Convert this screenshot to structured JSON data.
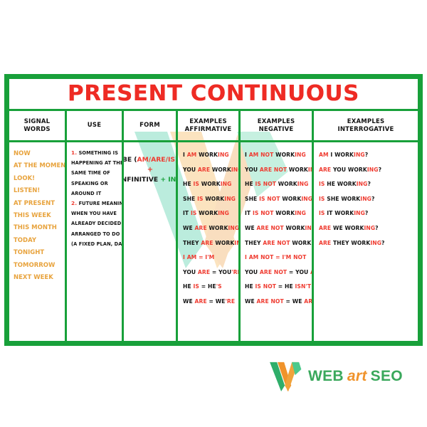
{
  "title": "PRESENT CONTINUOUS",
  "colors": {
    "frame_green": "#18a03a",
    "title_red": "#ee2b24",
    "accent_red": "#ef3b30",
    "signal_orange": "#e8a33d",
    "text_black": "#141414",
    "logo_green": "#3aa85c",
    "logo_orange": "#f0932b"
  },
  "headers": [
    {
      "line1": "SIGNAL WORDS",
      "line2": ""
    },
    {
      "line1": "USE",
      "line2": ""
    },
    {
      "line1": "FORM",
      "line2": ""
    },
    {
      "line1": "EXAMPLES",
      "line2": "AFFIRMATIVE"
    },
    {
      "line1": "EXAMPLES",
      "line2": "NEGATIVE"
    },
    {
      "line1": "EXAMPLES",
      "line2": "INTERROGATIVE"
    }
  ],
  "signal_words": [
    "NOW",
    "AT THE MOMENT",
    "LOOK!",
    "LISTEN!",
    "AT PRESENT",
    "THIS WEEK",
    "THIS MONTH",
    "TODAY",
    "TONIGHT",
    "TOMORROW",
    "NEXT WEEK"
  ],
  "use": [
    {
      "num": "1.",
      "text": "SOMETHING IS"
    },
    {
      "num": "",
      "text": "HAPPENING AT THE"
    },
    {
      "num": "",
      "text": "SAME TIME OF"
    },
    {
      "num": "",
      "text": "SPEAKING OR"
    },
    {
      "num": "",
      "text": "AROUND IT"
    },
    {
      "num": "2.",
      "text": "FUTURE MEANING:"
    },
    {
      "num": "",
      "text": "WHEN YOU HAVE"
    },
    {
      "num": "",
      "text": "ALREADY DECIDED AND"
    },
    {
      "num": "",
      "text": "ARRANGED TO DO IT"
    },
    {
      "num": "",
      "text": "(A FIXED PLAN, DATE)"
    }
  ],
  "form": {
    "line1_pre": "BE (",
    "line1_red": "AM/ARE/IS",
    "line1_post": ")",
    "plus1": "+",
    "line2_black": "INFINITIVE",
    "line2_green": "+ ING"
  },
  "affirmative": [
    {
      "subject": "I",
      "aux": "AM",
      "verb": "WORK",
      "ing": "ING"
    },
    {
      "subject": "YOU",
      "aux": "ARE",
      "verb": "WORK",
      "ing": "ING"
    },
    {
      "subject": "HE",
      "aux": "IS",
      "verb": "WORK",
      "ing": "ING"
    },
    {
      "subject": "SHE",
      "aux": "IS",
      "verb": "WORK",
      "ing": "ING"
    },
    {
      "subject": "IT",
      "aux": "IS",
      "verb": "WORK",
      "ing": "ING"
    },
    {
      "subject": "WE",
      "aux": "ARE",
      "verb": "WORK",
      "ing": "ING"
    },
    {
      "subject": "THEY",
      "aux": "ARE",
      "verb": "WORK",
      "ing": "ING"
    }
  ],
  "affirmative_contractions": [
    {
      "subject": "I",
      "aux": "AM",
      "eq": "=",
      "short_black": "I",
      "short_red": "'M"
    },
    {
      "subject": "YOU",
      "aux": "ARE",
      "eq": "=",
      "short_black": "YOU",
      "short_red": "'RE"
    },
    {
      "subject": "HE",
      "aux": "IS",
      "eq": "=",
      "short_black": "HE",
      "short_red": "'S"
    },
    {
      "subject": "WE",
      "aux": "ARE",
      "eq": "=",
      "short_black": "WE",
      "short_red": "'RE"
    }
  ],
  "negative": [
    {
      "subject": "I",
      "aux": "AM NOT",
      "verb": "WORK",
      "ing": "ING"
    },
    {
      "subject": "YOU",
      "aux": "ARE NOT",
      "verb": "WORK",
      "ing": "ING"
    },
    {
      "subject": "HE",
      "aux": "IS NOT",
      "verb": "WORK",
      "ing": "ING"
    },
    {
      "subject": "SHE",
      "aux": "IS NOT",
      "verb": "WORK",
      "ing": "ING"
    },
    {
      "subject": "IT",
      "aux": "IS NOT",
      "verb": "WORK",
      "ing": "ING"
    },
    {
      "subject": "WE",
      "aux": "ARE NOT",
      "verb": "WORK",
      "ing": "ING"
    },
    {
      "subject": "THEY",
      "aux": "ARE NOT",
      "verb": "WORK",
      "ing": "ING"
    }
  ],
  "negative_contractions": [
    {
      "subject": "I",
      "aux": "AM NOT",
      "eq": "=",
      "short_black": "I'M NOT",
      "short_red": ""
    },
    {
      "subject": "YOU",
      "aux": "ARE NOT",
      "eq": "=",
      "short_black": "YOU",
      "short_red": "AREN'T"
    },
    {
      "subject": "HE",
      "aux": "IS NOT",
      "eq": "=",
      "short_black": "HE",
      "short_red": "ISN'T"
    },
    {
      "subject": "WE",
      "aux": "ARE NOT",
      "eq": "=",
      "short_black": "WE",
      "short_red": "AREN'T"
    }
  ],
  "interrogative": [
    {
      "aux": "AM",
      "subject": "I",
      "verb": "WORK",
      "ing": "ING",
      "mark": "?"
    },
    {
      "aux": "ARE",
      "subject": "YOU",
      "verb": "WORK",
      "ing": "ING",
      "mark": "?"
    },
    {
      "aux": "IS",
      "subject": "HE",
      "verb": "WORK",
      "ing": "ING",
      "mark": "?"
    },
    {
      "aux": "IS",
      "subject": "SHE",
      "verb": "WORK",
      "ing": "ING",
      "mark": "?"
    },
    {
      "aux": "IS",
      "subject": "IT",
      "verb": "WORK",
      "ing": "ING",
      "mark": "?"
    },
    {
      "aux": "ARE",
      "subject": "WE",
      "verb": "WORK",
      "ing": "ING",
      "mark": "?"
    },
    {
      "aux": "ARE",
      "subject": "THEY",
      "verb": "WORK",
      "ing": "ING",
      "mark": "?"
    }
  ],
  "logo": {
    "web": "WEB",
    "art": "art",
    "seo": "SEO"
  }
}
